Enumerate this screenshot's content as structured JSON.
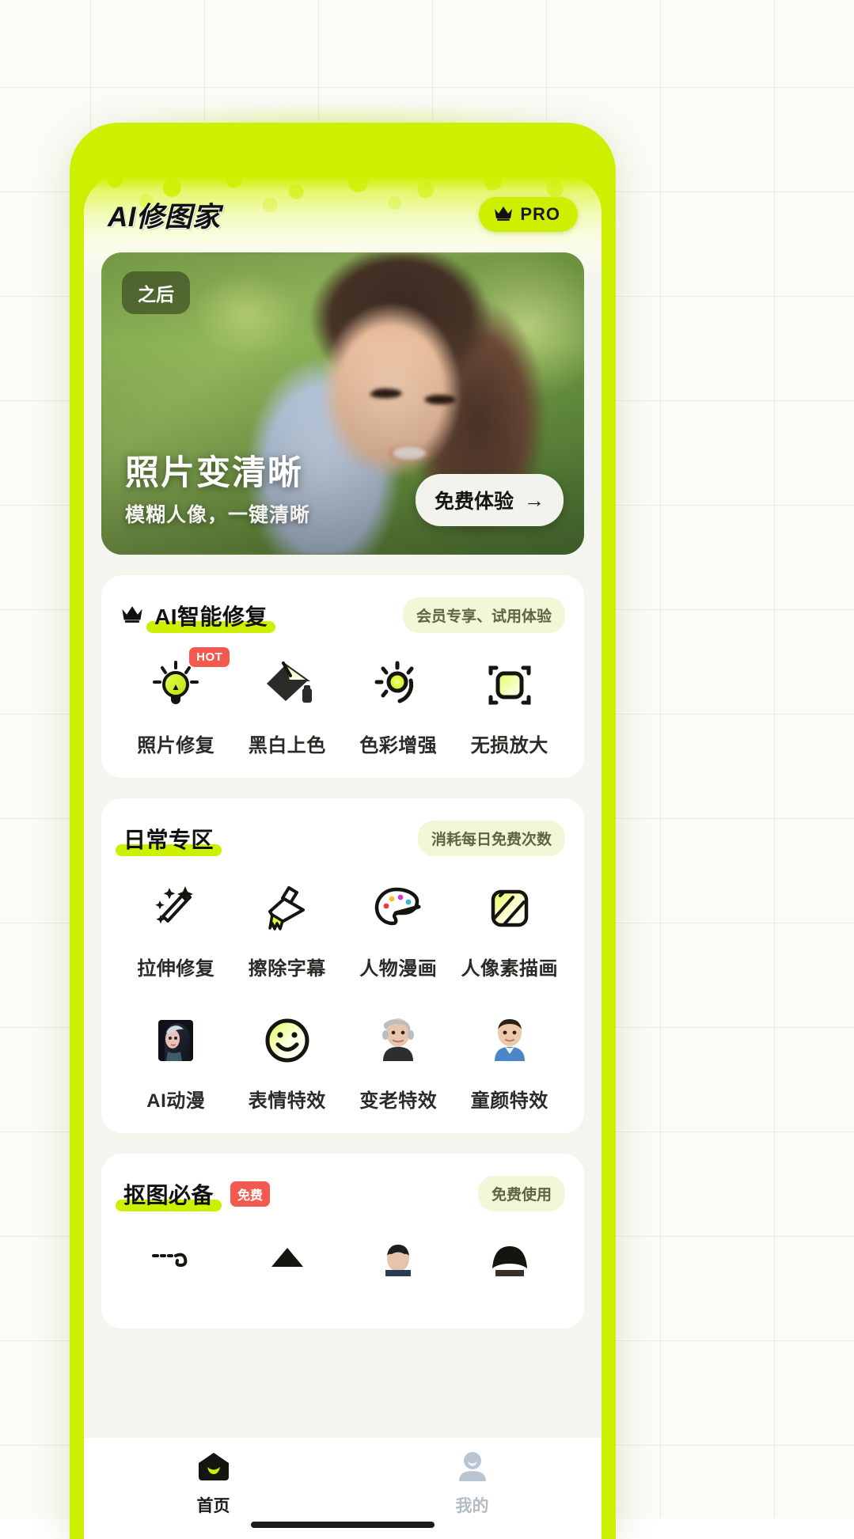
{
  "app": {
    "title": "AI修图家",
    "pro_label": "PRO",
    "pro_icon": "crown-icon"
  },
  "hero": {
    "tag": "之后",
    "title": "照片变清晰",
    "subtitle": "模糊人像，一键清晰",
    "cta_label": "免费体验",
    "cta_arrow": "→"
  },
  "sections": [
    {
      "id": "ai-restore",
      "title": "AI智能修复",
      "title_icon": "crown-icon",
      "badge": "会员专享、试用体验",
      "items": [
        {
          "label": "照片修复",
          "icon": "lightbulb-icon",
          "tag": "HOT"
        },
        {
          "label": "黑白上色",
          "icon": "color-fill-image-icon",
          "tag": ""
        },
        {
          "label": "色彩增强",
          "icon": "brightness-sun-icon",
          "tag": ""
        },
        {
          "label": "无损放大",
          "icon": "scale-frame-icon",
          "tag": ""
        }
      ]
    },
    {
      "id": "daily",
      "title": "日常专区",
      "title_icon": "",
      "badge": "消耗每日免费次数",
      "items": [
        {
          "label": "拉伸修复",
          "icon": "magic-wand-icon",
          "tag": ""
        },
        {
          "label": "擦除字幕",
          "icon": "brush-icon",
          "tag": ""
        },
        {
          "label": "人物漫画",
          "icon": "palette-icon",
          "tag": ""
        },
        {
          "label": "人像素描画",
          "icon": "sketch-hatch-icon",
          "tag": ""
        },
        {
          "label": "AI动漫",
          "icon": "anime-portrait-icon",
          "tag": ""
        },
        {
          "label": "表情特效",
          "icon": "smiley-icon",
          "tag": ""
        },
        {
          "label": "变老特效",
          "icon": "old-person-icon",
          "tag": ""
        },
        {
          "label": "童颜特效",
          "icon": "young-person-icon",
          "tag": ""
        }
      ]
    },
    {
      "id": "cutout",
      "title": "抠图必备",
      "title_badge": "免费",
      "badge": "免费使用",
      "items": [
        {
          "label": "",
          "icon": "lasso-cut-icon",
          "tag": ""
        },
        {
          "label": "",
          "icon": "mountain-icon",
          "tag": ""
        },
        {
          "label": "",
          "icon": "portrait-cutout-icon",
          "tag": ""
        },
        {
          "label": "",
          "icon": "hair-cutout-icon",
          "tag": ""
        }
      ]
    }
  ],
  "tabbar": {
    "items": [
      {
        "label": "首页",
        "icon": "home-icon",
        "state": "active"
      },
      {
        "label": "我的",
        "icon": "profile-icon",
        "state": "inactive"
      }
    ]
  },
  "colors": {
    "brand_green": "#cdf000",
    "accent_red": "#f4594f",
    "text_dark": "#111111",
    "badge_bg": "#f1f8d8"
  }
}
